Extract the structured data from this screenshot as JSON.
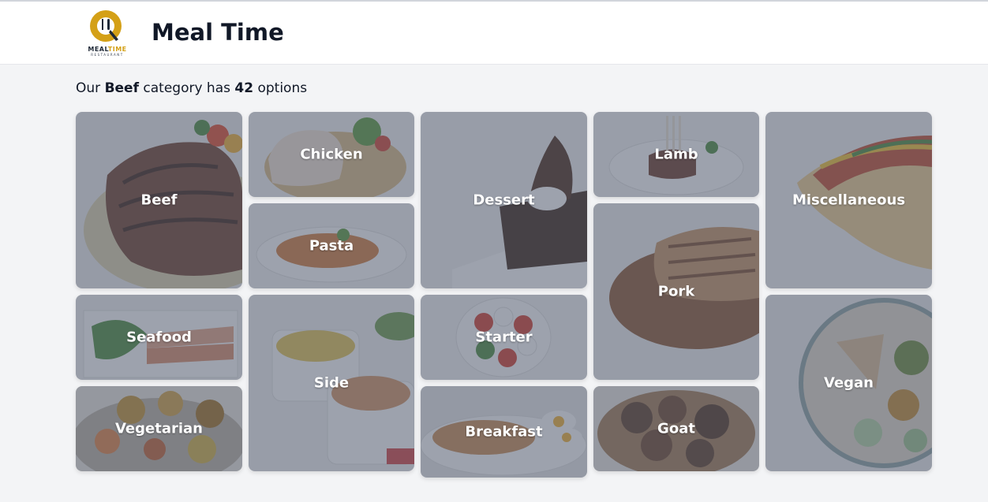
{
  "app": {
    "title": "Meal Time",
    "logo": {
      "word_dark": "MEAL",
      "word_accent": "TIME",
      "sub": "RESTAURANT",
      "icon": "fork-knife-logo-icon",
      "accent_color": "#d4a017"
    }
  },
  "summary": {
    "prefix": "Our",
    "category": "Beef",
    "middle": "category has",
    "count": "42",
    "suffix": "options"
  },
  "categories": [
    {
      "label": "Beef",
      "icon": "steak-image",
      "color": "#8b5a3c"
    },
    {
      "label": "Chicken",
      "icon": "chicken-image",
      "color": "#e8d2b8"
    },
    {
      "label": "Dessert",
      "icon": "chocolate-cake-image",
      "color": "#5a3a2a"
    },
    {
      "label": "Lamb",
      "icon": "lamb-chops-image",
      "color": "#6b4030"
    },
    {
      "label": "Miscellaneous",
      "icon": "taco-image",
      "color": "#e0b070"
    },
    {
      "label": "Pasta",
      "icon": "penne-pasta-image",
      "color": "#d08040"
    },
    {
      "label": "Pork",
      "icon": "pork-chop-image",
      "color": "#b07040"
    },
    {
      "label": "Seafood",
      "icon": "shrimp-plate-image",
      "color": "#d09070"
    },
    {
      "label": "Side",
      "icon": "side-salad-image",
      "color": "#e0c080"
    },
    {
      "label": "Starter",
      "icon": "caprese-image",
      "color": "#c04040"
    },
    {
      "label": "Vegan",
      "icon": "vegan-bowl-image",
      "color": "#80a060"
    },
    {
      "label": "Vegetarian",
      "icon": "thali-image",
      "color": "#d09030"
    },
    {
      "label": "Breakfast",
      "icon": "pancakes-image",
      "color": "#c08050"
    },
    {
      "label": "Goat",
      "icon": "goat-curry-image",
      "color": "#6a4a30"
    }
  ]
}
